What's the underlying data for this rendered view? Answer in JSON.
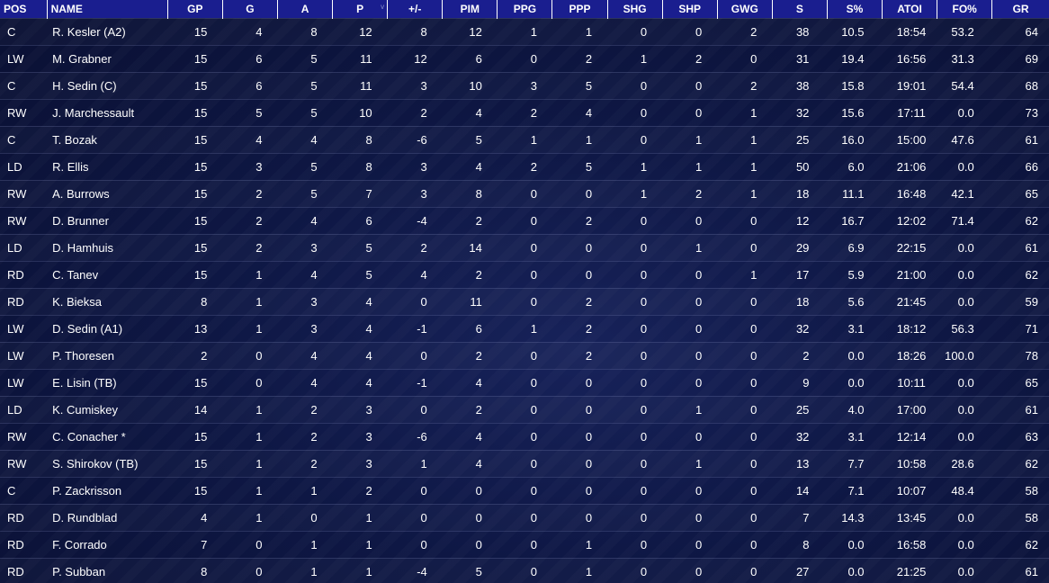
{
  "columns": [
    {
      "key": "pos",
      "label": "POS"
    },
    {
      "key": "name",
      "label": "NAME"
    },
    {
      "key": "gp",
      "label": "GP"
    },
    {
      "key": "g",
      "label": "G"
    },
    {
      "key": "a",
      "label": "A"
    },
    {
      "key": "p",
      "label": "P",
      "sort_icon": "v"
    },
    {
      "key": "pm",
      "label": "+/-"
    },
    {
      "key": "pim",
      "label": "PIM"
    },
    {
      "key": "ppg",
      "label": "PPG"
    },
    {
      "key": "ppp",
      "label": "PPP"
    },
    {
      "key": "shg",
      "label": "SHG"
    },
    {
      "key": "shp",
      "label": "SHP"
    },
    {
      "key": "gwg",
      "label": "GWG"
    },
    {
      "key": "s",
      "label": "S"
    },
    {
      "key": "sp",
      "label": "S%"
    },
    {
      "key": "atoi",
      "label": "ATOI"
    },
    {
      "key": "fo",
      "label": "FO%"
    },
    {
      "key": "gr",
      "label": "GR"
    }
  ],
  "rows": [
    [
      "C",
      "R. Kesler (A2)",
      "15",
      "4",
      "8",
      "12",
      "8",
      "12",
      "1",
      "1",
      "0",
      "0",
      "2",
      "38",
      "10.5",
      "18:54",
      "53.2",
      "64"
    ],
    [
      "LW",
      "M. Grabner",
      "15",
      "6",
      "5",
      "11",
      "12",
      "6",
      "0",
      "2",
      "1",
      "2",
      "0",
      "31",
      "19.4",
      "16:56",
      "31.3",
      "69"
    ],
    [
      "C",
      "H. Sedin (C)",
      "15",
      "6",
      "5",
      "11",
      "3",
      "10",
      "3",
      "5",
      "0",
      "0",
      "2",
      "38",
      "15.8",
      "19:01",
      "54.4",
      "68"
    ],
    [
      "RW",
      "J. Marchessault",
      "15",
      "5",
      "5",
      "10",
      "2",
      "4",
      "2",
      "4",
      "0",
      "0",
      "1",
      "32",
      "15.6",
      "17:11",
      "0.0",
      "73"
    ],
    [
      "C",
      "T. Bozak",
      "15",
      "4",
      "4",
      "8",
      "-6",
      "5",
      "1",
      "1",
      "0",
      "1",
      "1",
      "25",
      "16.0",
      "15:00",
      "47.6",
      "61"
    ],
    [
      "LD",
      "R. Ellis",
      "15",
      "3",
      "5",
      "8",
      "3",
      "4",
      "2",
      "5",
      "1",
      "1",
      "1",
      "50",
      "6.0",
      "21:06",
      "0.0",
      "66"
    ],
    [
      "RW",
      "A. Burrows",
      "15",
      "2",
      "5",
      "7",
      "3",
      "8",
      "0",
      "0",
      "1",
      "2",
      "1",
      "18",
      "11.1",
      "16:48",
      "42.1",
      "65"
    ],
    [
      "RW",
      "D. Brunner",
      "15",
      "2",
      "4",
      "6",
      "-4",
      "2",
      "0",
      "2",
      "0",
      "0",
      "0",
      "12",
      "16.7",
      "12:02",
      "71.4",
      "62"
    ],
    [
      "LD",
      "D. Hamhuis",
      "15",
      "2",
      "3",
      "5",
      "2",
      "14",
      "0",
      "0",
      "0",
      "1",
      "0",
      "29",
      "6.9",
      "22:15",
      "0.0",
      "61"
    ],
    [
      "RD",
      "C. Tanev",
      "15",
      "1",
      "4",
      "5",
      "4",
      "2",
      "0",
      "0",
      "0",
      "0",
      "1",
      "17",
      "5.9",
      "21:00",
      "0.0",
      "62"
    ],
    [
      "RD",
      "K. Bieksa",
      "8",
      "1",
      "3",
      "4",
      "0",
      "11",
      "0",
      "2",
      "0",
      "0",
      "0",
      "18",
      "5.6",
      "21:45",
      "0.0",
      "59"
    ],
    [
      "LW",
      "D. Sedin (A1)",
      "13",
      "1",
      "3",
      "4",
      "-1",
      "6",
      "1",
      "2",
      "0",
      "0",
      "0",
      "32",
      "3.1",
      "18:12",
      "56.3",
      "71"
    ],
    [
      "LW",
      "P. Thoresen",
      "2",
      "0",
      "4",
      "4",
      "0",
      "2",
      "0",
      "2",
      "0",
      "0",
      "0",
      "2",
      "0.0",
      "18:26",
      "100.0",
      "78"
    ],
    [
      "LW",
      "E. Lisin (TB)",
      "15",
      "0",
      "4",
      "4",
      "-1",
      "4",
      "0",
      "0",
      "0",
      "0",
      "0",
      "9",
      "0.0",
      "10:11",
      "0.0",
      "65"
    ],
    [
      "LD",
      "K. Cumiskey",
      "14",
      "1",
      "2",
      "3",
      "0",
      "2",
      "0",
      "0",
      "0",
      "1",
      "0",
      "25",
      "4.0",
      "17:00",
      "0.0",
      "61"
    ],
    [
      "RW",
      "C. Conacher *",
      "15",
      "1",
      "2",
      "3",
      "-6",
      "4",
      "0",
      "0",
      "0",
      "0",
      "0",
      "32",
      "3.1",
      "12:14",
      "0.0",
      "63"
    ],
    [
      "RW",
      "S. Shirokov (TB)",
      "15",
      "1",
      "2",
      "3",
      "1",
      "4",
      "0",
      "0",
      "0",
      "1",
      "0",
      "13",
      "7.7",
      "10:58",
      "28.6",
      "62"
    ],
    [
      "C",
      "P. Zackrisson",
      "15",
      "1",
      "1",
      "2",
      "0",
      "0",
      "0",
      "0",
      "0",
      "0",
      "0",
      "14",
      "7.1",
      "10:07",
      "48.4",
      "58"
    ],
    [
      "RD",
      "D. Rundblad",
      "4",
      "1",
      "0",
      "1",
      "0",
      "0",
      "0",
      "0",
      "0",
      "0",
      "0",
      "7",
      "14.3",
      "13:45",
      "0.0",
      "58"
    ],
    [
      "RD",
      "F. Corrado",
      "7",
      "0",
      "1",
      "1",
      "0",
      "0",
      "0",
      "1",
      "0",
      "0",
      "0",
      "8",
      "0.0",
      "16:58",
      "0.0",
      "62"
    ],
    [
      "RD",
      "P. Subban",
      "8",
      "0",
      "1",
      "1",
      "-4",
      "5",
      "0",
      "1",
      "0",
      "0",
      "0",
      "27",
      "0.0",
      "21:25",
      "0.0",
      "61"
    ]
  ]
}
